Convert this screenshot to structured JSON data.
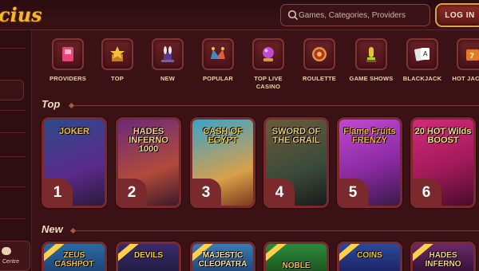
{
  "header": {
    "logo_text": "cius",
    "search_placeholder": "Games, Categories, Providers",
    "login_label": "LOG IN"
  },
  "sidebar": {
    "support_label": "Centre"
  },
  "categories": [
    {
      "label": "PROVIDERS",
      "icon": "book-icon",
      "color": "#e8457a"
    },
    {
      "label": "TOP",
      "icon": "star-box-icon",
      "color": "#f2c13a"
    },
    {
      "label": "NEW",
      "icon": "magic-hat-icon",
      "color": "#9b7cc9"
    },
    {
      "label": "POPULAR",
      "icon": "jester-hat-icon",
      "color": "#e85b3a"
    },
    {
      "label": "TOP LIVE CASINO",
      "icon": "crystal-ball-icon",
      "color": "#c04ad2"
    },
    {
      "label": "ROULETTE",
      "icon": "roulette-wheel-icon",
      "color": "#d89a3a"
    },
    {
      "label": "GAME SHOWS",
      "icon": "trophy-icon",
      "color": "#e2c23a"
    },
    {
      "label": "BLACKJACK",
      "icon": "cards-icon",
      "color": "#e6e6e6"
    },
    {
      "label": "HOT JACKPO",
      "icon": "jackpot-icon",
      "color": "#e27a2a"
    }
  ],
  "sections": {
    "top": "Top",
    "new": "New"
  },
  "top_games": [
    {
      "title": "JOKER",
      "rank": "1",
      "bg": "#2d4a8a",
      "accent": "#f2c13a"
    },
    {
      "title": "HADES INFERNO 1000",
      "rank": "2",
      "bg": "#6a2a7a",
      "accent": "#f26a2a"
    },
    {
      "title": "CASH OF EGYPT",
      "rank": "3",
      "bg": "#3aa2c9",
      "accent": "#f2c13a"
    },
    {
      "title": "SWORD OF THE GRAIL",
      "rank": "4",
      "bg": "#4a3a2a",
      "accent": "#d8b060"
    },
    {
      "title": "Flame Fruits FRENZY",
      "rank": "5",
      "bg": "#8a2aa2",
      "accent": "#f2a02a"
    },
    {
      "title": "20 HOT Wilds BOOST",
      "rank": "6",
      "bg": "#a21a5a",
      "accent": "#f2d03a"
    }
  ],
  "new_games": [
    {
      "title": "ZEUS CASHPOT",
      "bg": "#2a6aa2",
      "accent": "#f2c13a"
    },
    {
      "title": "DEVILS",
      "bg": "#3a2a6a",
      "accent": "#f2d03a"
    },
    {
      "title": "MAJESTIC CLEOPATRA",
      "bg": "#3a7ab2",
      "accent": "#f7e0a0"
    },
    {
      "title": "NOBLE",
      "bg": "#2a8a3a",
      "accent": "#f2c13a"
    },
    {
      "title": "COINS",
      "bg": "#2a4a9a",
      "accent": "#f2c13a"
    },
    {
      "title": "HADES INFERNO",
      "bg": "#6a2a6a",
      "accent": "#f26a2a"
    }
  ]
}
